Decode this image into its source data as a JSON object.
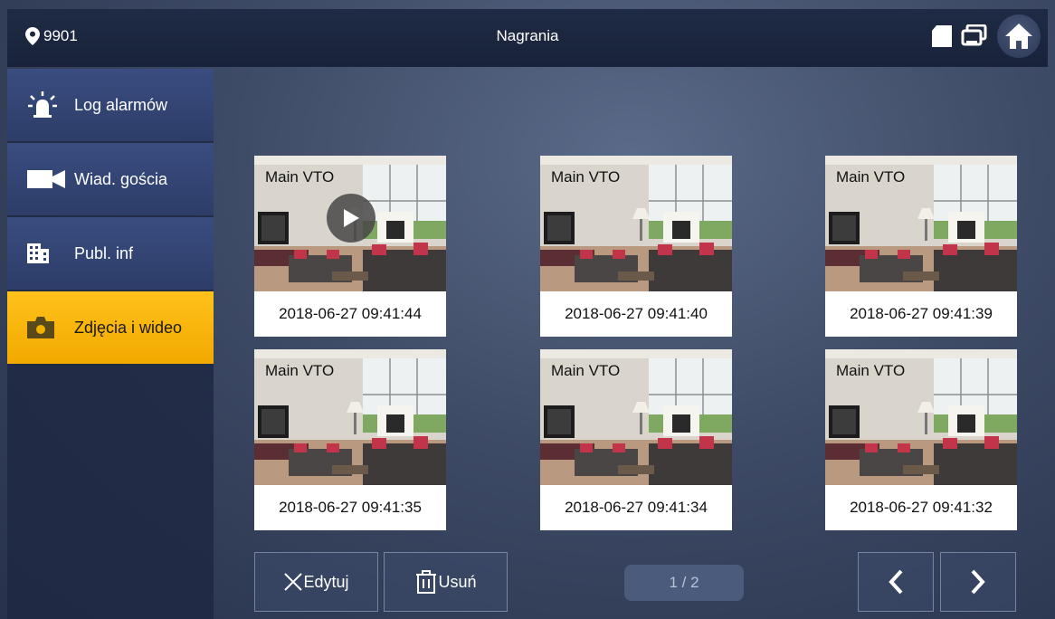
{
  "header": {
    "location": "9901",
    "title": "Nagrania"
  },
  "sidebar": {
    "items": [
      {
        "label": "Log alarmów",
        "icon": "alarm-light-icon",
        "active": false
      },
      {
        "label": "Wiad. gościa",
        "icon": "video-camera-icon",
        "active": false
      },
      {
        "label": "Publ. inf",
        "icon": "building-icon",
        "active": false
      },
      {
        "label": "Zdjęcia i wideo",
        "icon": "camera-icon",
        "active": true
      }
    ]
  },
  "records": [
    {
      "source": "Main VTO",
      "timestamp": "2018-06-27 09:41:44",
      "type": "video"
    },
    {
      "source": "Main VTO",
      "timestamp": "2018-06-27 09:41:40",
      "type": "photo"
    },
    {
      "source": "Main VTO",
      "timestamp": "2018-06-27 09:41:39",
      "type": "photo"
    },
    {
      "source": "Main VTO",
      "timestamp": "2018-06-27 09:41:35",
      "type": "photo"
    },
    {
      "source": "Main VTO",
      "timestamp": "2018-06-27 09:41:34",
      "type": "photo"
    },
    {
      "source": "Main VTO",
      "timestamp": "2018-06-27 09:41:32",
      "type": "photo"
    }
  ],
  "footer": {
    "edit_label": "Edytuj",
    "delete_label": "Usuń",
    "page_indicator": "1 / 2"
  },
  "colors": {
    "accent": "#f5b400",
    "sidebar_item": "#34467a",
    "header": "#1c263f"
  }
}
